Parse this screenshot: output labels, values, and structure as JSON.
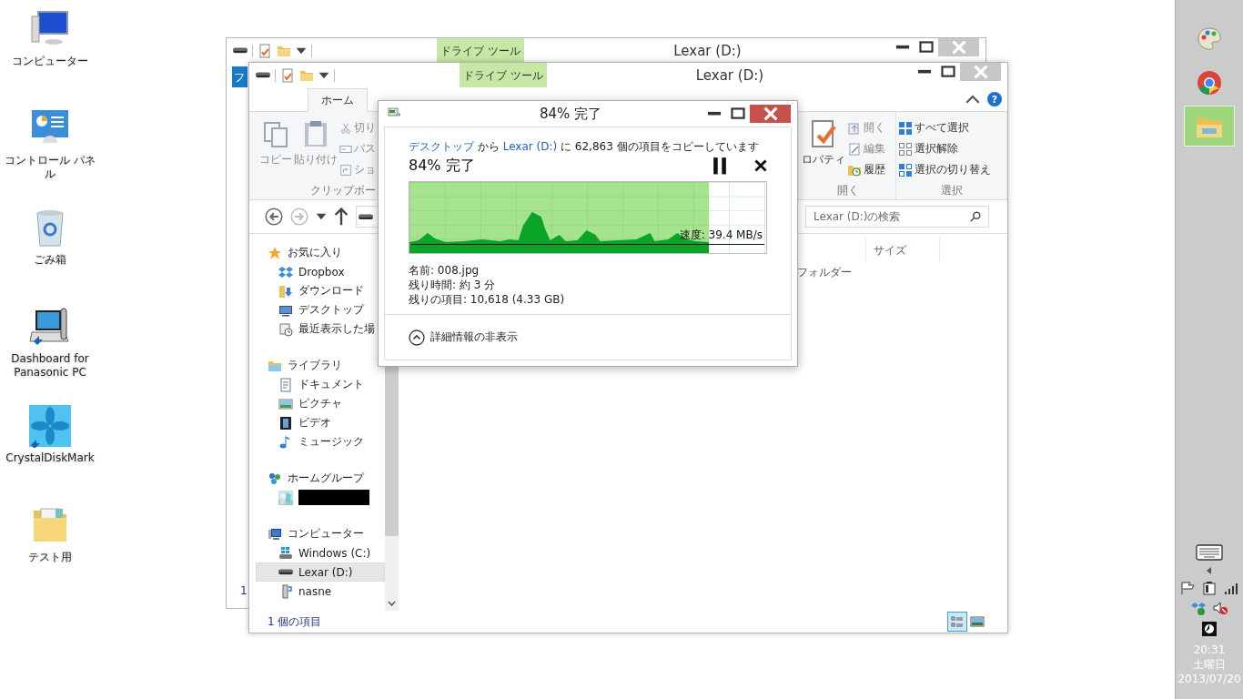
{
  "desktop_icons": [
    {
      "label": "コンピューター",
      "kind": "computer"
    },
    {
      "label": "コントロール パネル",
      "kind": "control"
    },
    {
      "label": "ごみ箱",
      "kind": "bin"
    },
    {
      "label": "Dashboard for Panasonic PC",
      "kind": "dashboard"
    },
    {
      "label": "CrystalDiskMark",
      "kind": "flower"
    },
    {
      "label": "テスト用",
      "kind": "folder"
    }
  ],
  "back_window": {
    "file_tab": "フ",
    "context_tab": "ドライブ ツール",
    "title": "Lexar (D:)",
    "status": "1"
  },
  "window": {
    "context_tab": "ドライブ ツール",
    "title": "Lexar (D:)",
    "tabs": [
      {
        "label": "ホーム",
        "selected": true
      }
    ],
    "help": "?",
    "clipboard": {
      "large": [
        {
          "label": "コピー",
          "kind": "copy",
          "disabled": true
        },
        {
          "label": "貼り付け",
          "kind": "paste",
          "disabled": true
        }
      ],
      "small": [
        {
          "label": "切り",
          "kind": "cut",
          "disabled": true
        },
        {
          "label": "パス",
          "kind": "path",
          "disabled": true
        },
        {
          "label": "ショ",
          "kind": "shortcut",
          "disabled": true
        }
      ],
      "label": "クリップボー"
    },
    "open_group": {
      "large": {
        "label": "ロパティ",
        "kind": "properties",
        "disabled": false
      },
      "small": [
        {
          "label": "開く",
          "kind": "open",
          "disabled": true
        },
        {
          "label": "編集",
          "kind": "edit",
          "disabled": true
        },
        {
          "label": "履歴",
          "kind": "history",
          "disabled": false
        }
      ],
      "label": "開く"
    },
    "select_group": {
      "items": [
        {
          "label": "すべて選択",
          "kind": "all"
        },
        {
          "label": "選択解除",
          "kind": "none"
        },
        {
          "label": "選択の切り替え",
          "kind": "invert"
        }
      ],
      "label": "選択"
    },
    "search": {
      "placeholder": "Lexar (D:)の検索"
    },
    "nav": [
      {
        "label": "お気に入り",
        "kind": "star",
        "selected": false,
        "children": [
          {
            "label": "Dropbox",
            "kind": "dropbox",
            "selected": false
          },
          {
            "label": "ダウンロード",
            "kind": "download",
            "selected": false
          },
          {
            "label": "デスクトップ",
            "kind": "desktop",
            "selected": false
          },
          {
            "label": "最近表示した場",
            "kind": "recent",
            "selected": false
          }
        ]
      },
      {
        "label": "ライブラリ",
        "kind": "library",
        "selected": false,
        "children": [
          {
            "label": "ドキュメント",
            "kind": "document",
            "selected": false
          },
          {
            "label": "ピクチャ",
            "kind": "picture",
            "selected": false
          },
          {
            "label": "ビデオ",
            "kind": "video",
            "selected": false
          },
          {
            "label": "ミュージック",
            "kind": "music",
            "selected": false
          }
        ]
      },
      {
        "label": "ホームグループ",
        "kind": "homegroup",
        "selected": false,
        "children": [
          {
            "kind": "redacted",
            "selected": false
          }
        ]
      },
      {
        "label": "コンピューター",
        "kind": "computer",
        "selected": false,
        "children": [
          {
            "label": "Windows (C:)",
            "kind": "windrive",
            "selected": false
          },
          {
            "label": "Lexar (D:)",
            "kind": "drive",
            "selected": true
          },
          {
            "label": "nasne",
            "kind": "nasne",
            "selected": false
          }
        ]
      }
    ],
    "column_header": "サイズ",
    "type_cell": "フォルダー",
    "status": "1 個の項目",
    "views": [
      {
        "kind": "details",
        "selected": true
      },
      {
        "kind": "thumbs",
        "selected": false
      }
    ]
  },
  "dialog": {
    "title": "84% 完了",
    "source": "デスクトップ",
    "from": "から",
    "destination": "Lexar (D:)",
    "rest": "に 62,863 個の項目をコピーしています",
    "heading": "84% 完了",
    "progress": {
      "level": 0.84
    },
    "speed": "速度: 39.4 MB/s",
    "details": [
      "名前: 008.jpg",
      "残り時間: 約 3 分",
      "残りの項目: 10,618 (4.33 GB)"
    ],
    "toggle": "詳細情報の非表示"
  },
  "taskbar": {
    "apps": [
      {
        "kind": "paint",
        "selected": false
      },
      {
        "kind": "browser",
        "selected": false
      },
      {
        "kind": "explorer",
        "selected": true
      }
    ],
    "time": "20:31",
    "day": "土曜日",
    "date": "2013/07/20"
  }
}
